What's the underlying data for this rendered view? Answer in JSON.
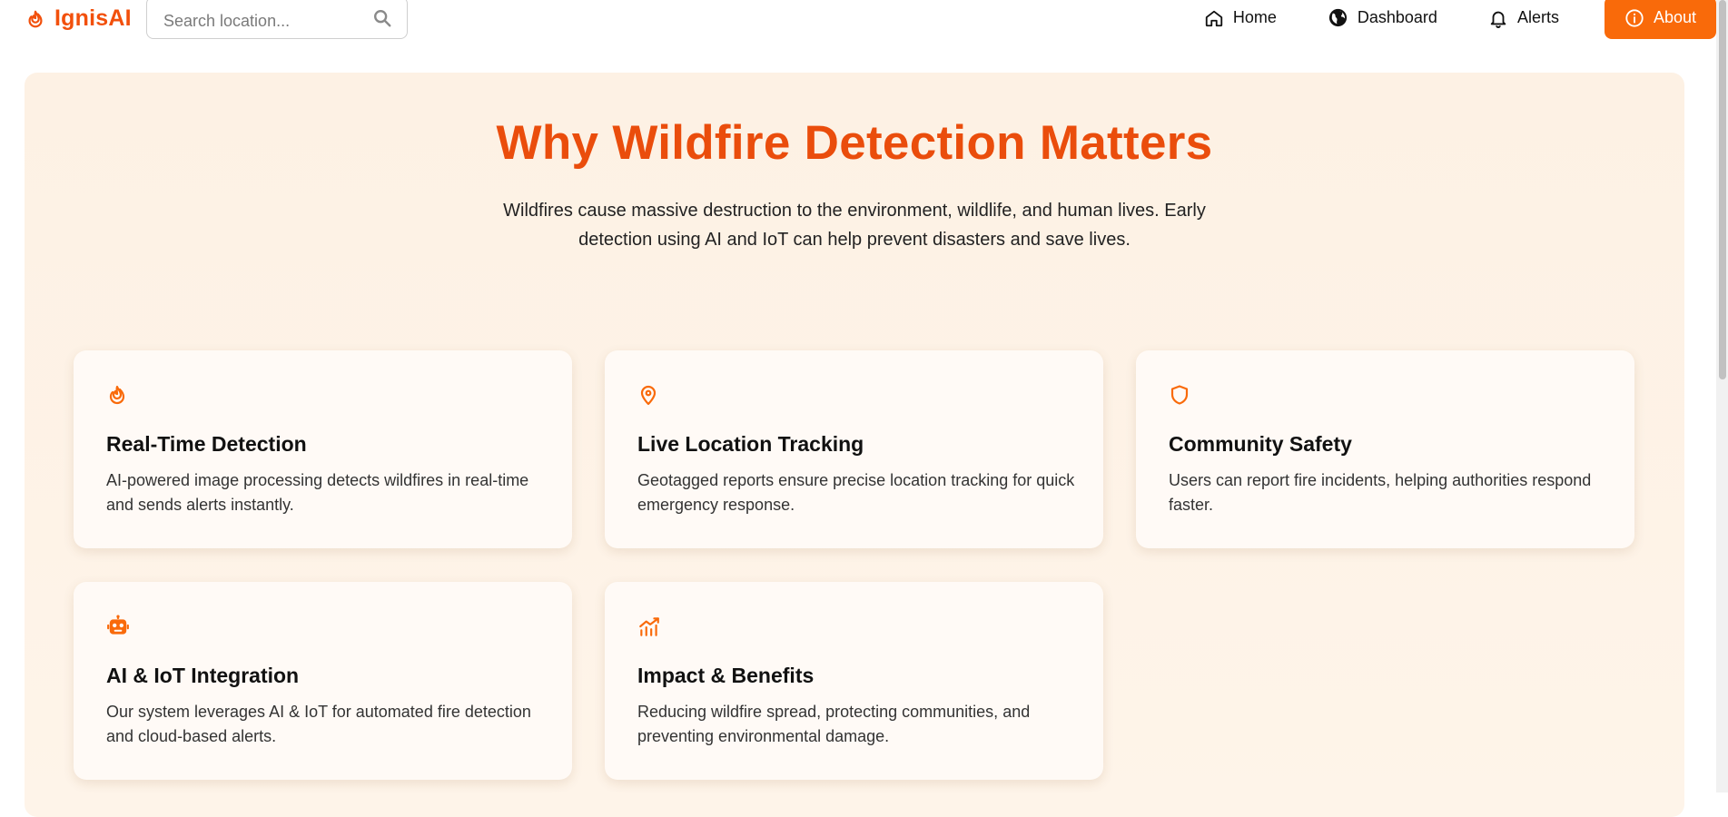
{
  "brand": {
    "name": "IgnisAI",
    "color": "#f2500c"
  },
  "search": {
    "placeholder": "Search location...",
    "value": ""
  },
  "nav": {
    "items": [
      {
        "label": "Home",
        "icon": "home-icon"
      },
      {
        "label": "Dashboard",
        "icon": "globe-icon"
      },
      {
        "label": "Alerts",
        "icon": "bell-icon"
      },
      {
        "label": "About",
        "icon": "info-icon",
        "active": true
      }
    ],
    "accent": "#f96a0a"
  },
  "hero": {
    "title": "Why Wildfire Detection Matters",
    "description": "Wildfires cause massive destruction to the environment, wildlife, and human lives. Early detection using AI and IoT can help prevent disasters and save lives."
  },
  "cards": [
    {
      "icon": "flame-icon",
      "title": "Real-Time Detection",
      "description": "AI-powered image processing detects wildfires in real-time and sends alerts instantly."
    },
    {
      "icon": "map-pin-icon",
      "title": "Live Location Tracking",
      "description": "Geotagged reports ensure precise location tracking for quick emergency response."
    },
    {
      "icon": "shield-icon",
      "title": "Community Safety",
      "description": "Users can report fire incidents, helping authorities respond faster."
    },
    {
      "icon": "robot-icon",
      "title": "AI & IoT Integration",
      "description": "Our system leverages AI & IoT for automated fire detection and cloud-based alerts."
    },
    {
      "icon": "chart-icon",
      "title": "Impact & Benefits",
      "description": "Reducing wildfire spread, protecting communities, and preventing environmental damage."
    }
  ],
  "colors": {
    "accent": "#f96a0a",
    "title": "#ea4d0c",
    "hero_bg": "#fdf1e4",
    "card_bg": "#fffaf6"
  }
}
